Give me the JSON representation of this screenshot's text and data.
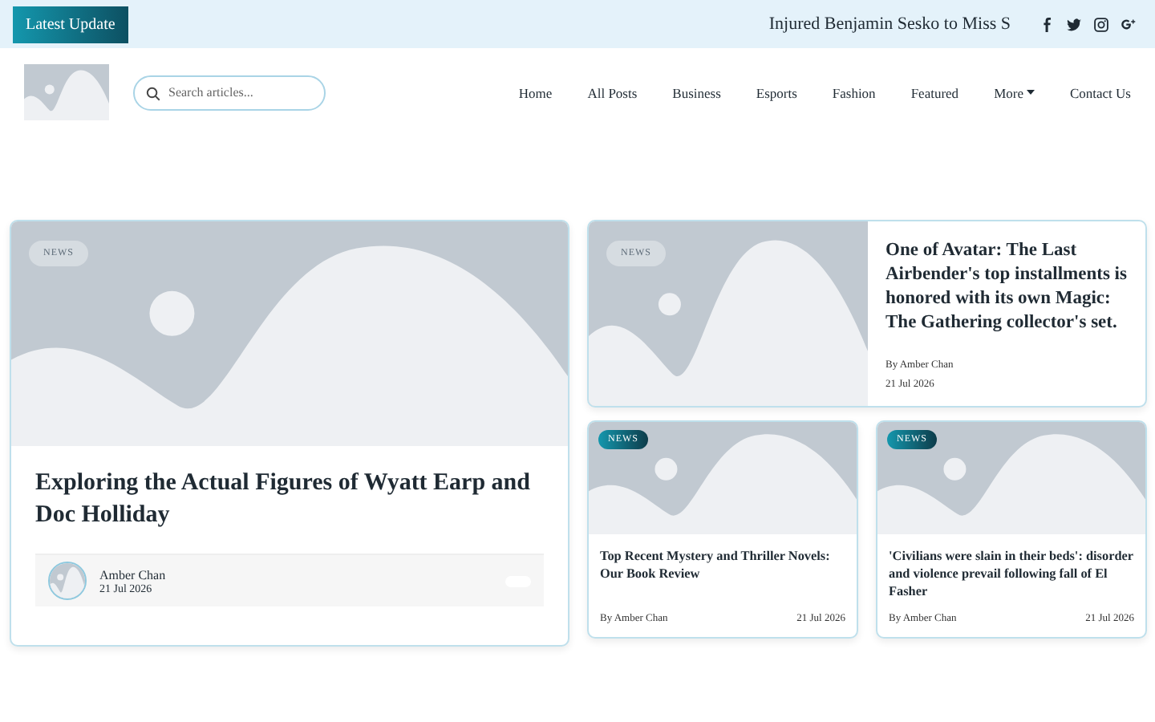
{
  "topbar": {
    "label": "Latest Update",
    "ticker": "Injured Benjamin Sesko to Miss S"
  },
  "search": {
    "placeholder": "Search articles..."
  },
  "nav": [
    {
      "label": "Home",
      "kind": "link"
    },
    {
      "label": "All Posts",
      "kind": "link"
    },
    {
      "label": "Business",
      "kind": "link"
    },
    {
      "label": "Esports",
      "kind": "link"
    },
    {
      "label": "Fashion",
      "kind": "link"
    },
    {
      "label": "Featured",
      "kind": "link"
    },
    {
      "label": "More",
      "kind": "dropdown"
    },
    {
      "label": "Contact Us",
      "kind": "link"
    }
  ],
  "featured": {
    "badge": {
      "label": "NEWS",
      "kind": "ghost"
    },
    "title": "Exploring the Actual Figures of Wyatt Earp and Doc Holliday",
    "author": "Amber Chan",
    "date": "21 Jul 2026"
  },
  "side_top": {
    "badge": {
      "label": "NEWS",
      "kind": "ghost"
    },
    "title": "One of Avatar: The Last Airbender's top installments is honored with its own Magic: The Gathering collector's set.",
    "byline": "By Amber Chan",
    "date": "21 Jul 2026"
  },
  "side_cards": [
    {
      "badge": {
        "label": "NEWS",
        "kind": "solid"
      },
      "title": "Top Recent Mystery and Thriller Novels: Our Book Review",
      "byline": "By Amber Chan",
      "date": "21 Jul 2026"
    },
    {
      "badge": {
        "label": "NEWS",
        "kind": "solid"
      },
      "title": "'Civilians were slain in their beds': disorder and violence prevail following fall of El Fasher",
      "byline": "By Amber Chan",
      "date": "21 Jul 2026"
    }
  ]
}
